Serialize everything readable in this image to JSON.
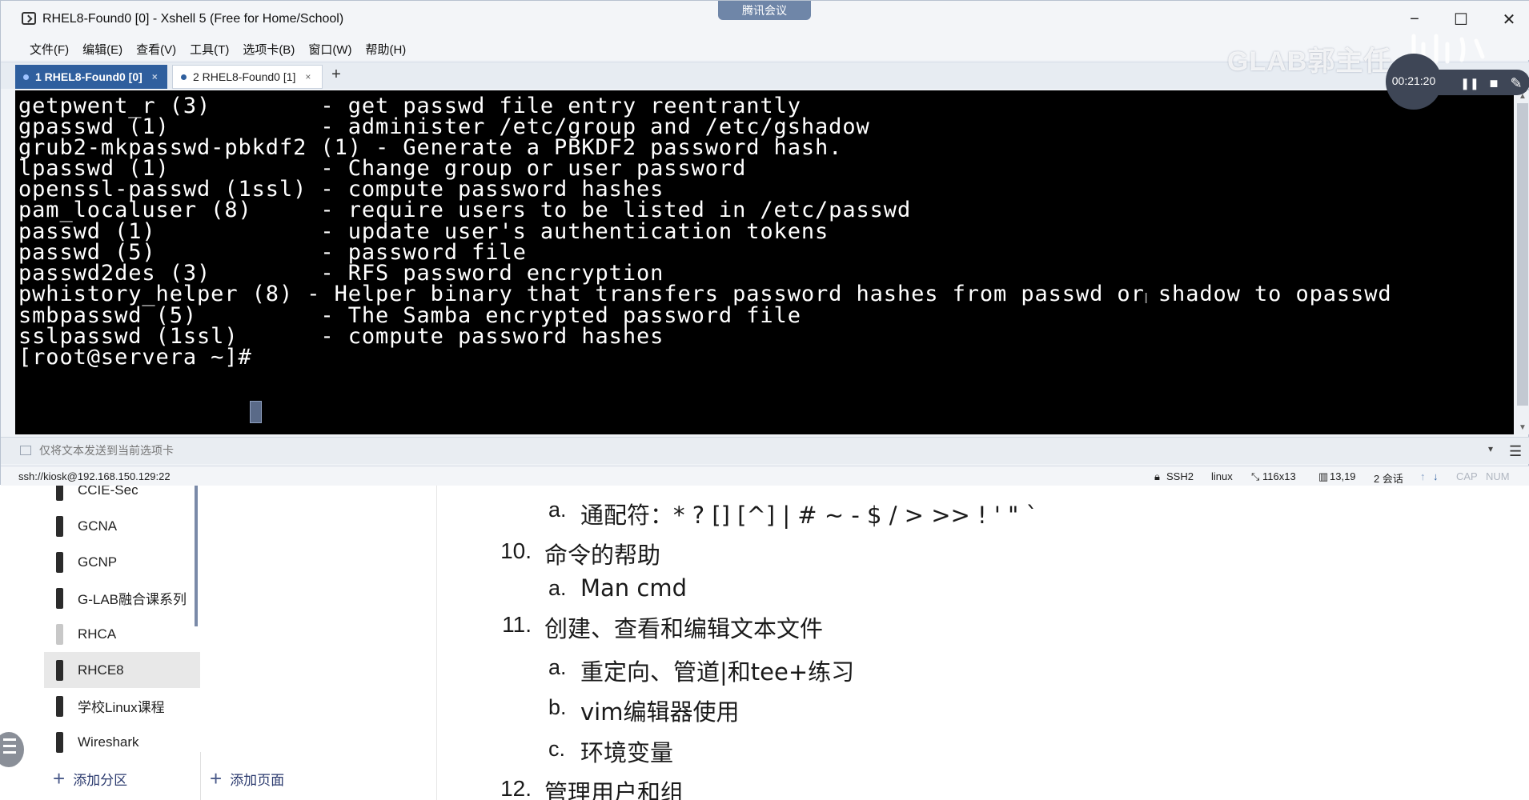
{
  "window": {
    "title": "RHEL8-Found0 [0] - Xshell 5 (Free for Home/School)",
    "meeting_badge": "腾讯会议",
    "minimize": "−",
    "maximize": "☐",
    "close": "✕"
  },
  "menu": [
    "文件(F)",
    "编辑(E)",
    "查看(V)",
    "工具(T)",
    "选项卡(B)",
    "窗口(W)",
    "帮助(H)"
  ],
  "tabs": [
    {
      "label": "1 RHEL8-Found0 [0]",
      "active": true,
      "close": "×"
    },
    {
      "label": "2 RHEL8-Found0 [1]",
      "active": false,
      "close": "×"
    }
  ],
  "tab_add": "+",
  "overlay": {
    "logo": "GLAB郭主任",
    "rec_time": "00:21:20",
    "pause": "❚❚",
    "stop": "■",
    "pen": "✎"
  },
  "terminal": {
    "lines": [
      "getpwent_r (3)        - get passwd file entry reentrantly",
      "gpasswd (1)           - administer /etc/group and /etc/gshadow",
      "grub2-mkpasswd-pbkdf2 (1) - Generate a PBKDF2 password hash.",
      "lpasswd (1)           - Change group or user password",
      "openssl-passwd (1ssl) - compute password hashes",
      "pam_localuser (8)     - require users to be listed in /etc/passwd",
      "passwd (1)            - update user's authentication tokens",
      "passwd (5)            - password file",
      "passwd2des (3)        - RFS password encryption",
      "pwhistory_helper (8) - Helper binary that transfers password hashes from passwd or shadow to opasswd",
      "smbpasswd (5)         - The Samba encrypted password file",
      "sslpasswd (1ssl)      - compute password hashes",
      "[root@servera ~]# "
    ],
    "ibeam": "I"
  },
  "compose": {
    "placeholder": "仅将文本发送到当前选项卡"
  },
  "status": {
    "address": "ssh://kiosk@192.168.150.129:22",
    "protocol": "SSH2",
    "term": "linux",
    "size": "116x13",
    "position": "13,19",
    "sessions": "2 会话",
    "caps": "CAP",
    "num": "NUM"
  },
  "notebook": {
    "sections": [
      {
        "label": "CCIE-Sec",
        "active": false,
        "faded": false
      },
      {
        "label": "GCNA",
        "active": false,
        "faded": false
      },
      {
        "label": "GCNP",
        "active": false,
        "faded": false
      },
      {
        "label": "G-LAB融合课系列",
        "active": false,
        "faded": false
      },
      {
        "label": "RHCA",
        "active": false,
        "faded": true
      },
      {
        "label": "RHCE8",
        "active": true,
        "faded": false
      },
      {
        "label": "学校Linux课程",
        "active": false,
        "faded": false
      },
      {
        "label": "Wireshark",
        "active": false,
        "faded": false
      }
    ],
    "add_section": "添加分区",
    "add_page": "添加页面",
    "content": {
      "wildcard_marker": "a.",
      "wildcard": "通配符：* ? [] [^] | # ~ - $ / > >> ! ' \"  `",
      "item10_num": "10.",
      "item10": "命令的帮助",
      "item10a_marker": "a.",
      "item10a": "Man cmd",
      "item11_num": "11.",
      "item11": "创建、查看和编辑文本文件",
      "item11a_marker": "a.",
      "item11a": "重定向、管道|和tee+练习",
      "item11b_marker": "b.",
      "item11b": "vim编辑器使用",
      "item11c_marker": "c.",
      "item11c": "环境变量",
      "item12_num": "12.",
      "item12": "管理用户和组"
    }
  }
}
